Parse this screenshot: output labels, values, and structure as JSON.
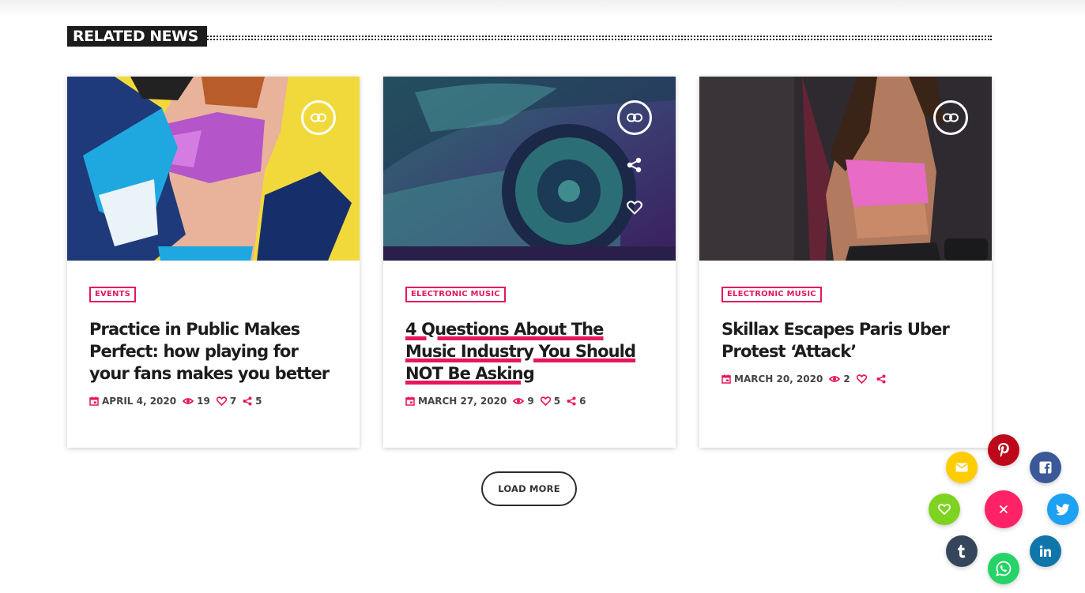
{
  "section": {
    "title": "RELATED NEWS"
  },
  "cards": [
    {
      "tag": "EVENTS",
      "title": "Practice in Public Makes Perfect: how playing for your fans makes you better",
      "date": "APRIL 4, 2020",
      "views": "19",
      "likes": "7",
      "shares": "5"
    },
    {
      "tag": "ELECTRONIC MUSIC",
      "title": "4 Questions About The Music Industry You Should NOT Be Asking",
      "date": "MARCH 27, 2020",
      "views": "9",
      "likes": "5",
      "shares": "6"
    },
    {
      "tag": "ELECTRONIC MUSIC",
      "title": "Skillax Escapes Paris Uber Protest ‘Attack’",
      "date": "MARCH 20, 2020",
      "views": "2",
      "likes": "",
      "shares": ""
    }
  ],
  "load_more": "LOAD MORE",
  "share_buttons": {
    "main": "close-icon",
    "items": [
      "pinterest-icon",
      "facebook-icon",
      "twitter-icon",
      "linkedin-icon",
      "whatsapp-icon",
      "tumblr-icon",
      "heart-icon",
      "email-icon"
    ]
  },
  "colors": {
    "accent": "#e6165e",
    "dark": "#1c1c1c",
    "pinterest": "#bd081c",
    "facebook": "#3b5998",
    "twitter": "#1da1f2",
    "linkedin": "#0e76a8",
    "whatsapp": "#25d366",
    "tumblr": "#35465c",
    "heart": "#7ed321",
    "email": "#ffcc00"
  }
}
